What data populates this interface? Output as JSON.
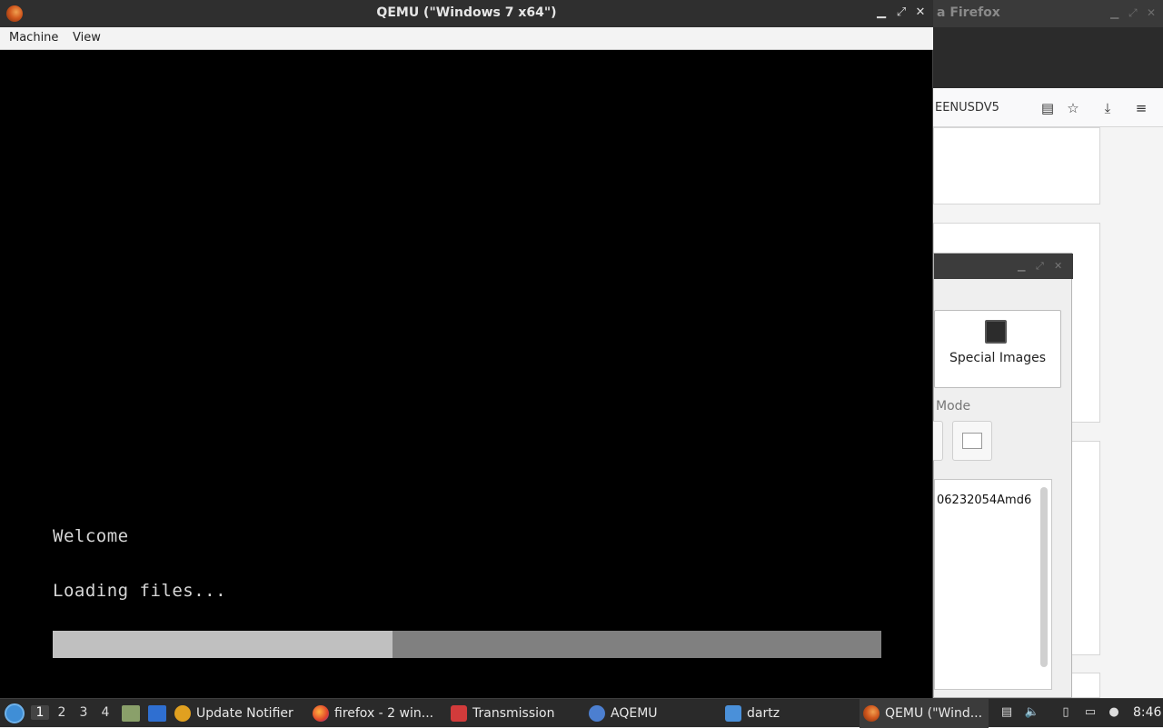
{
  "background_firefox": {
    "title_fragment": "a Firefox",
    "url_fragment": "EENUSDV5"
  },
  "aqemu": {
    "special_images_label": "Special Images",
    "mode_label": "Mode",
    "list_item": "06232054Amd6"
  },
  "qemu": {
    "title": "QEMU (\"Windows 7 x64\")",
    "menu": [
      "Machine",
      "View"
    ],
    "screen_lines": [
      "Welcome",
      "Loading files..."
    ],
    "progress_percent": 41,
    "colors": {
      "progress_fill": "#c0c0c0",
      "progress_track": "#808080",
      "screen_bg": "#000000"
    }
  },
  "taskbar": {
    "workspaces": [
      "1",
      "2",
      "3",
      "4"
    ],
    "active_workspace": "1",
    "tasks": [
      {
        "label": "Update Notifier",
        "icon": "update-notifier-icon"
      },
      {
        "label": "firefox - 2 win...",
        "icon": "firefox-icon"
      },
      {
        "label": "Transmission",
        "icon": "transmission-icon"
      },
      {
        "label": "AQEMU",
        "icon": "aqemu-icon"
      },
      {
        "label": "dartz",
        "icon": "folder-icon"
      },
      {
        "label": "QEMU (\"Wind...",
        "icon": "qemu-icon"
      }
    ],
    "clock": "8:46"
  }
}
